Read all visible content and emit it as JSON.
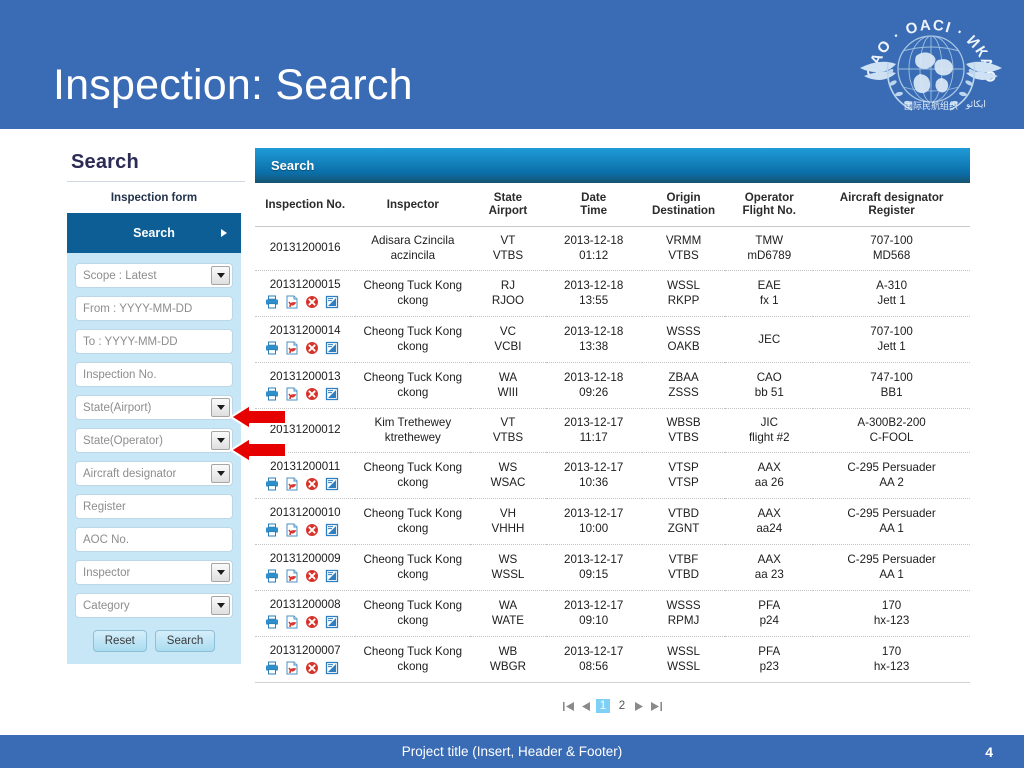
{
  "slide": {
    "title": "Inspection: Search",
    "logo_alt": "icao-logo",
    "logo_text_outer": "ICAO · OACI · ИКАО",
    "brand_blue": "#3a6cb5"
  },
  "sidebar": {
    "title": "Search",
    "subtitle": "Inspection form",
    "accordion": {
      "label": "Search",
      "expanded": true
    },
    "fields": [
      {
        "name": "scope",
        "value": "Scope : Latest",
        "type": "select"
      },
      {
        "name": "date-from",
        "value": "From : YYYY-MM-DD",
        "type": "text"
      },
      {
        "name": "date-to",
        "value": "To : YYYY-MM-DD",
        "type": "text"
      },
      {
        "name": "inspection-no",
        "value": "Inspection No.",
        "type": "text"
      },
      {
        "name": "state-airport",
        "value": "State(Airport)",
        "type": "select"
      },
      {
        "name": "state-operator",
        "value": "State(Operator)",
        "type": "select"
      },
      {
        "name": "aircraft-designator",
        "value": "Aircraft designator",
        "type": "select"
      },
      {
        "name": "register",
        "value": "Register",
        "type": "text"
      },
      {
        "name": "aoc-no",
        "value": "AOC No.",
        "type": "text"
      },
      {
        "name": "inspector",
        "value": "Inspector",
        "type": "select"
      },
      {
        "name": "category",
        "value": "Category",
        "type": "select"
      }
    ],
    "buttons": {
      "reset": "Reset",
      "search": "Search"
    }
  },
  "results": {
    "panel_title": "Search",
    "columns": [
      {
        "l1": "Inspection No.",
        "l2": ""
      },
      {
        "l1": "Inspector",
        "l2": ""
      },
      {
        "l1": "State",
        "l2": "Airport"
      },
      {
        "l1": "Date",
        "l2": "Time"
      },
      {
        "l1": "Origin",
        "l2": "Destination"
      },
      {
        "l1": "Operator",
        "l2": "Flight No."
      },
      {
        "l1": "Aircraft designator",
        "l2": "Register"
      }
    ],
    "rows": [
      {
        "no": "20131200016",
        "actions": false,
        "inspector1": "Adisara Czincila",
        "inspector2": "aczincila",
        "state": "VT",
        "airport": "VTBS",
        "date": "2013-12-18",
        "time": "01:12",
        "origin": "VRMM",
        "dest": "VTBS",
        "operator": "TMW",
        "flight": "mD6789",
        "acft": "707-100",
        "register": "MD568"
      },
      {
        "no": "20131200015",
        "actions": true,
        "inspector1": "Cheong Tuck Kong",
        "inspector2": "ckong",
        "state": "RJ",
        "airport": "RJOO",
        "date": "2013-12-18",
        "time": "13:55",
        "origin": "WSSL",
        "dest": "RKPP",
        "operator": "EAE",
        "flight": "fx 1",
        "acft": "A-310",
        "register": "Jett 1"
      },
      {
        "no": "20131200014",
        "actions": true,
        "inspector1": "Cheong Tuck Kong",
        "inspector2": "ckong",
        "state": "VC",
        "airport": "VCBI",
        "date": "2013-12-18",
        "time": "13:38",
        "origin": "WSSS",
        "dest": "OAKB",
        "operator": "JEC",
        "flight": "",
        "acft": "707-100",
        "register": "Jett 1"
      },
      {
        "no": "20131200013",
        "actions": true,
        "inspector1": "Cheong Tuck Kong",
        "inspector2": "ckong",
        "state": "WA",
        "airport": "WIII",
        "date": "2013-12-18",
        "time": "09:26",
        "origin": "ZBAA",
        "dest": "ZSSS",
        "operator": "CAO",
        "flight": "bb 51",
        "acft": "747-100",
        "register": "BB1"
      },
      {
        "no": "20131200012",
        "actions": false,
        "inspector1": "Kim Trethewey",
        "inspector2": "ktrethewey",
        "state": "VT",
        "airport": "VTBS",
        "date": "2013-12-17",
        "time": "11:17",
        "origin": "WBSB",
        "dest": "VTBS",
        "operator": "JIC",
        "flight": "flight #2",
        "acft": "A-300B2-200",
        "register": "C-FOOL"
      },
      {
        "no": "20131200011",
        "actions": true,
        "inspector1": "Cheong Tuck Kong",
        "inspector2": "ckong",
        "state": "WS",
        "airport": "WSAC",
        "date": "2013-12-17",
        "time": "10:36",
        "origin": "VTSP",
        "dest": "VTSP",
        "operator": "AAX",
        "flight": "aa 26",
        "acft": "C-295 Persuader",
        "register": "AA 2"
      },
      {
        "no": "20131200010",
        "actions": true,
        "inspector1": "Cheong Tuck Kong",
        "inspector2": "ckong",
        "state": "VH",
        "airport": "VHHH",
        "date": "2013-12-17",
        "time": "10:00",
        "origin": "VTBD",
        "dest": "ZGNT",
        "operator": "AAX",
        "flight": "aa24",
        "acft": "C-295 Persuader",
        "register": "AA 1"
      },
      {
        "no": "20131200009",
        "actions": true,
        "inspector1": "Cheong Tuck Kong",
        "inspector2": "ckong",
        "state": "WS",
        "airport": "WSSL",
        "date": "2013-12-17",
        "time": "09:15",
        "origin": "VTBF",
        "dest": "VTBD",
        "operator": "AAX",
        "flight": "aa 23",
        "acft": "C-295 Persuader",
        "register": "AA 1"
      },
      {
        "no": "20131200008",
        "actions": true,
        "inspector1": "Cheong Tuck Kong",
        "inspector2": "ckong",
        "state": "WA",
        "airport": "WATE",
        "date": "2013-12-17",
        "time": "09:10",
        "origin": "WSSS",
        "dest": "RPMJ",
        "operator": "PFA",
        "flight": "p24",
        "acft": "170",
        "register": "hx-123"
      },
      {
        "no": "20131200007",
        "actions": true,
        "inspector1": "Cheong Tuck Kong",
        "inspector2": "ckong",
        "state": "WB",
        "airport": "WBGR",
        "date": "2013-12-17",
        "time": "08:56",
        "origin": "WSSL",
        "dest": "WSSL",
        "operator": "PFA",
        "flight": "p23",
        "acft": "170",
        "register": "hx-123"
      }
    ],
    "row_action_icons": [
      "print-icon",
      "pdf-icon",
      "delete-icon",
      "edit-icon"
    ],
    "pagination": {
      "pages": [
        "1",
        "2"
      ],
      "active": "1"
    }
  },
  "footer": {
    "text": "Project title (Insert, Header & Footer)",
    "page": "4"
  },
  "annotations": {
    "arrow_color": "#e00000",
    "arrows": [
      {
        "name": "arrow-state-airport",
        "points_to": "state-airport"
      },
      {
        "name": "arrow-state-operator",
        "points_to": "state-operator"
      }
    ]
  }
}
